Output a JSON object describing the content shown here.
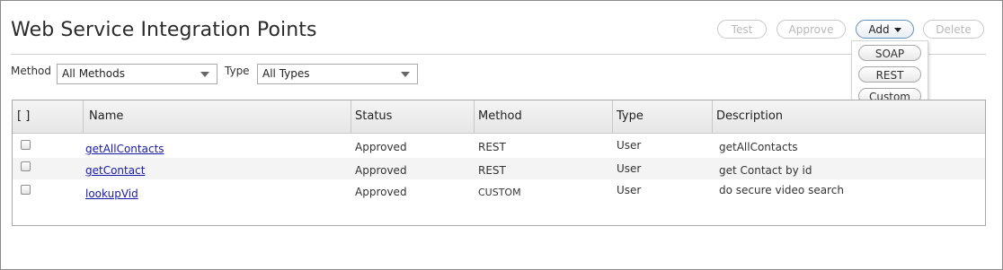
{
  "page": {
    "title": "Web Service Integration Points"
  },
  "toolbar": {
    "test_label": "Test",
    "approve_label": "Approve",
    "add_label": "Add",
    "delete_label": "Delete"
  },
  "add_menu": {
    "items": [
      "SOAP",
      "REST",
      "Custom"
    ]
  },
  "filters": {
    "method_label": "Method",
    "method_value": "All Methods",
    "type_label": "Type",
    "type_value": "All Types"
  },
  "table": {
    "columns": [
      "[ ]",
      "Name",
      "Status",
      "Method",
      "Type",
      "Description"
    ],
    "rows": [
      {
        "name": "getAllContacts",
        "status": "Approved",
        "method": "REST",
        "type": "User",
        "description": "getAllContacts"
      },
      {
        "name": "getContact",
        "status": "Approved",
        "method": "REST",
        "type": "User",
        "description": "get Contact by id"
      },
      {
        "name": "lookupVid",
        "status": "Approved",
        "method": "CUSTOM",
        "type": "User",
        "description": "do secure video search"
      }
    ]
  },
  "colors": {
    "link": "#1a1aa8",
    "pointer_hand": "#f5a623"
  },
  "icons": [
    "pointing-hand-icon",
    "dropdown-arrow-icon",
    "checkbox-icon"
  ]
}
